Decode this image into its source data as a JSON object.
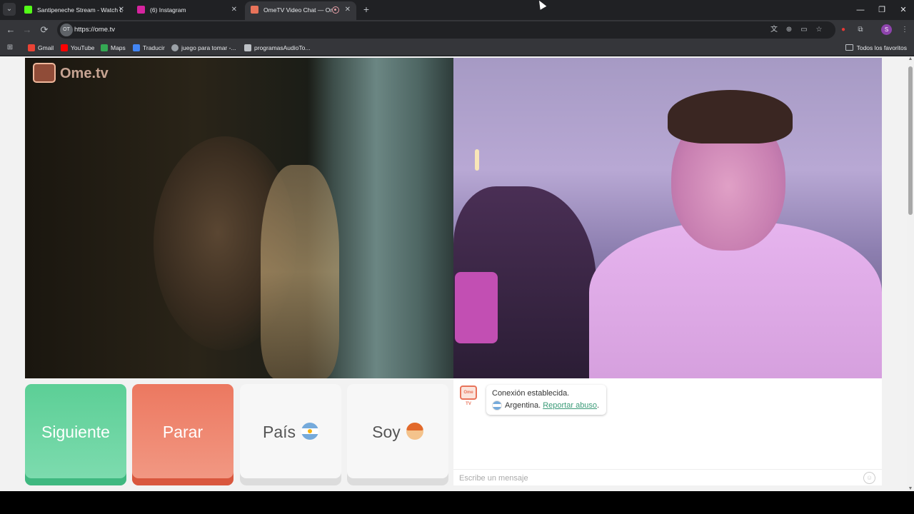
{
  "tabs": [
    {
      "title": "Santipeneche Stream - Watch L",
      "favicon_color": "#53fc18"
    },
    {
      "title": "(6) Instagram",
      "favicon_color": "#d6249f"
    },
    {
      "title": "OmeTV Video Chat — Ome",
      "favicon_color": "#e8735a"
    }
  ],
  "window_controls": {
    "minimize": "—",
    "restore": "❐",
    "close": "✕"
  },
  "toolbar": {
    "url": "https://ome.tv",
    "back": "←",
    "forward": "→",
    "reload": "⟳",
    "site_icon": "OT",
    "profile_initial": "S"
  },
  "bookmarks": [
    {
      "label": "Gmail",
      "color": "#ea4335"
    },
    {
      "label": "YouTube",
      "color": "#ff0000"
    },
    {
      "label": "Maps",
      "color": "#34a853"
    },
    {
      "label": "Traducir",
      "color": "#4285f4"
    },
    {
      "label": "juego para tomar -...",
      "color": "#9aa0a6"
    },
    {
      "label": "programasAudioTo...",
      "color": "#bdc1c6"
    }
  ],
  "bookmarks_all": "Todos los favoritos",
  "video": {
    "logo_text": "Ome.tv"
  },
  "controls": {
    "next": "Siguiente",
    "stop": "Parar",
    "country": "País",
    "gender": "Soy"
  },
  "chat": {
    "logo": "Ome TV",
    "status": "Conexión establecida.",
    "country": "Argentina.",
    "report": "Reportar abuso",
    "report_suffix": ".",
    "placeholder": "Escribe un mensaje"
  }
}
